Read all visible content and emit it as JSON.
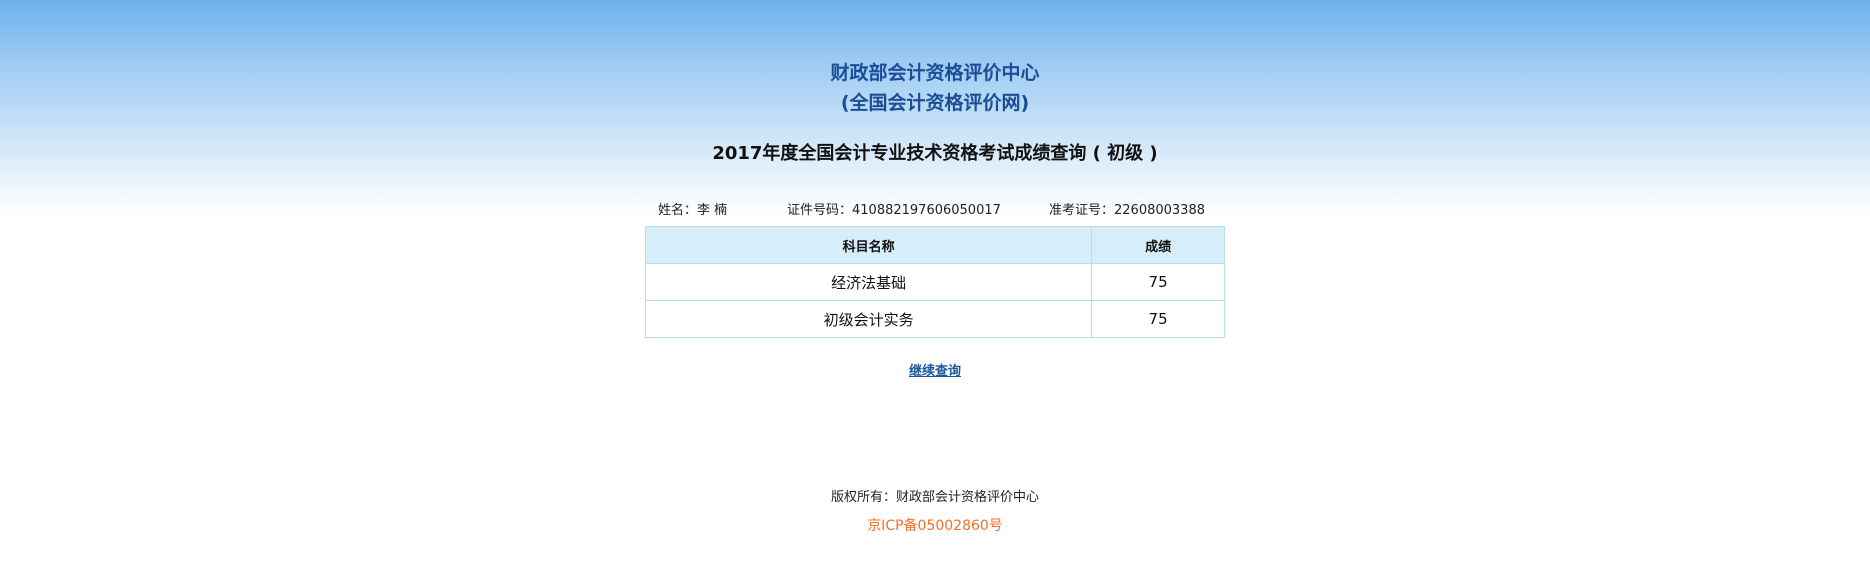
{
  "header": {
    "org_name": "财政部会计资格评价中心",
    "org_site": "(全国会计资格评价网)",
    "exam_title": "2017年度全国会计专业技术资格考试成绩查询 ( 初级 )"
  },
  "candidate": {
    "name_label": "姓名：",
    "name_value": "李 楠",
    "id_label": "证件号码：",
    "id_value": "410882197606050017",
    "exam_no_label": "准考证号：",
    "exam_no_value": "22608003388"
  },
  "table": {
    "headers": [
      "科目名称",
      "成绩"
    ],
    "rows": [
      {
        "subject": "经济法基础",
        "score": "75"
      },
      {
        "subject": "初级会计实务",
        "score": "75"
      }
    ]
  },
  "actions": {
    "continue_label": "继续查询"
  },
  "footer": {
    "copyright": "版权所有：财政部会计资格评价中心",
    "icp": "京ICP备05002860号"
  },
  "colors": {
    "title_blue": "#1c4e97",
    "header_gradient_top": "#6fb2ec",
    "table_header_bg": "#d6eef9",
    "table_border": "#b7dbef",
    "link": "#1a5a9a",
    "icp_orange": "#f0712a"
  }
}
